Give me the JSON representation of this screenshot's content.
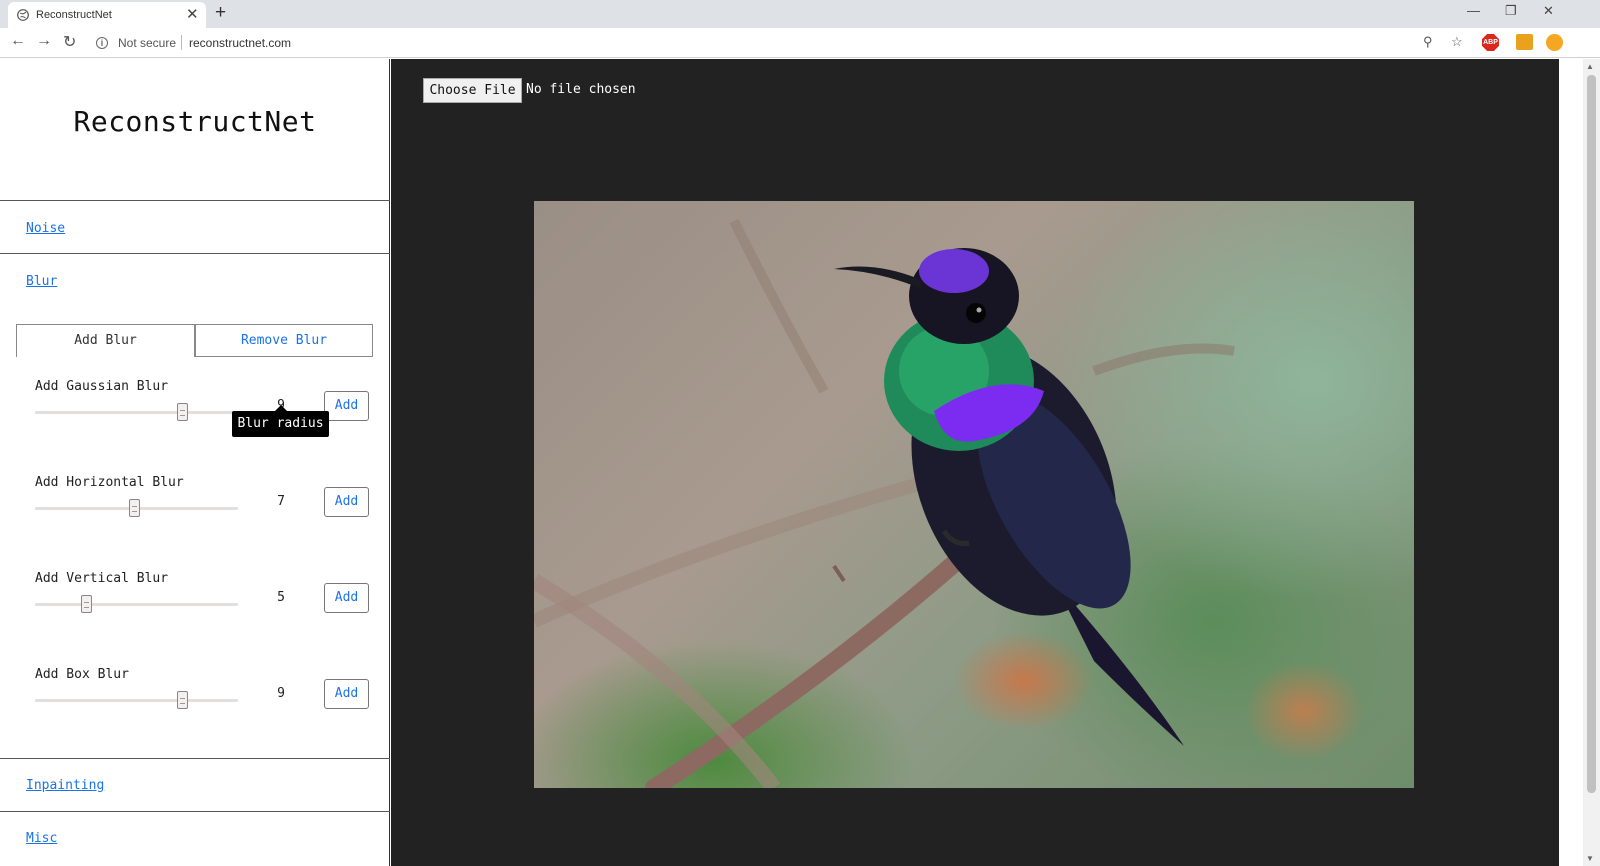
{
  "browser": {
    "tab_title": "ReconstructNet",
    "new_tab_glyph": "+",
    "close_glyph": "✕",
    "security_label": "Not secure",
    "url": "reconstructnet.com",
    "icons": [
      "back-icon",
      "forward-icon",
      "reload-icon",
      "info-icon",
      "zoom-icon",
      "star-icon",
      "abp-icon",
      "media-icon",
      "puzzle-icon",
      "profile-icon"
    ],
    "abp_label": "ABP"
  },
  "sidebar": {
    "title": "ReconstructNet",
    "sections": {
      "noise": "Noise",
      "blur": "Blur",
      "inpainting": "Inpainting",
      "misc": "Misc"
    },
    "blur_tabs": {
      "add": "Add Blur",
      "remove": "Remove Blur",
      "active": "add"
    },
    "controls": [
      {
        "label": "Add Gaussian Blur",
        "value": "9",
        "fraction": 0.75,
        "button": "Add"
      },
      {
        "label": "Add Horizontal Blur",
        "value": "7",
        "fraction": 0.5,
        "button": "Add"
      },
      {
        "label": "Add Vertical Blur",
        "value": "5",
        "fraction": 0.25,
        "button": "Add"
      },
      {
        "label": "Add Box Blur",
        "value": "9",
        "fraction": 0.75,
        "button": "Add"
      }
    ],
    "tooltip": "Blur radius"
  },
  "main": {
    "file_button": "Choose File",
    "file_status": "No file chosen",
    "image_subject": "hummingbird perched on branch",
    "colors": {
      "panel_bg": "#222222",
      "link": "#1a73e8"
    }
  }
}
